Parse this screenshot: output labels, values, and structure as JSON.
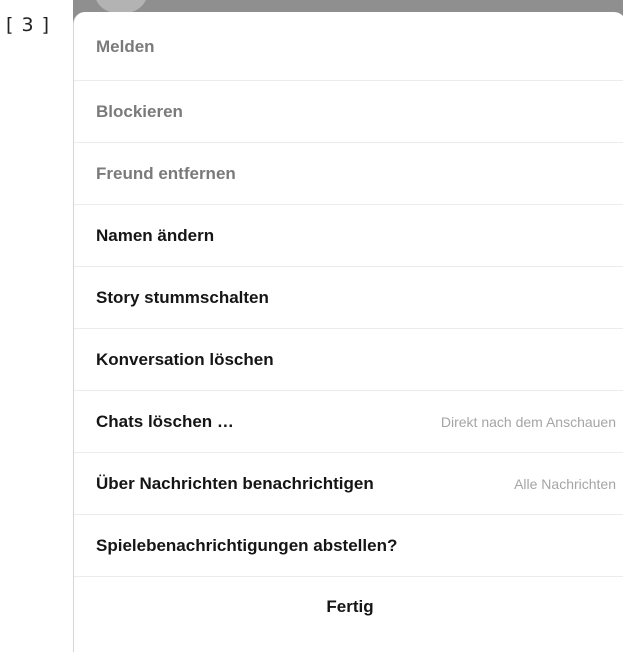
{
  "figure_label": "[ 3 ]",
  "menu": {
    "items": [
      {
        "label": "Melden",
        "muted": true
      },
      {
        "label": "Blockieren",
        "muted": true
      },
      {
        "label": "Freund entfernen",
        "muted": true
      },
      {
        "label": "Namen ändern",
        "muted": false
      },
      {
        "label": "Story stummschalten",
        "muted": false
      },
      {
        "label": "Konversation löschen",
        "muted": false
      },
      {
        "label": "Chats löschen …",
        "value": "Direkt nach dem Anschauen",
        "muted": false
      },
      {
        "label": "Über Nachrichten benachrichtigen",
        "value": "Alle Nachrichten",
        "muted": false
      },
      {
        "label": "Spielebenachrichtigungen abstellen?",
        "muted": false
      }
    ],
    "done_label": "Fertig"
  },
  "colors": {
    "primary_text": "#151515",
    "muted_text": "#7a7a7a",
    "value_text": "#a5a5a5",
    "divider": "#ececec",
    "backdrop": "#8f8f8f"
  }
}
